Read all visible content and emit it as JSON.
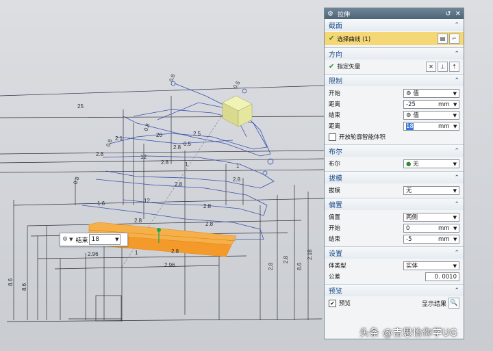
{
  "float_input": {
    "label": "结束",
    "value": "18"
  },
  "canvas": {
    "dims": [
      "0.8",
      "0.8",
      "0.8",
      "0.8",
      "25",
      "20",
      "2.1",
      "0.5",
      "2.5",
      "2.8",
      "2.8",
      "2.8",
      "2.8",
      "12",
      "12",
      "1",
      "1",
      "2.8",
      "2.8",
      "2.8",
      "2.8",
      "2.8",
      "1.6",
      "1",
      "2.96",
      "2.96",
      "8.6",
      "8.6",
      "2.8",
      "2.8",
      "2.18",
      "0.5",
      "8.6"
    ]
  },
  "dialog": {
    "title": "拉伸",
    "section_profile": {
      "title": "截面",
      "select_label": "选择曲线 (1)"
    },
    "section_direction": {
      "title": "方向",
      "vector_label": "指定矢量"
    },
    "section_limits": {
      "title": "限制",
      "start_label": "开始",
      "start_value": "值",
      "start_dist_label": "距离",
      "start_dist_value": "-25",
      "start_dist_unit": "mm",
      "end_label": "结束",
      "end_value": "值",
      "end_dist_label": "距离",
      "end_dist_value": "18",
      "end_dist_unit": "mm",
      "open_profile_label": "开放轮廓智能体积"
    },
    "section_boolean": {
      "title": "布尔",
      "label": "布尔",
      "value": "无"
    },
    "section_draft": {
      "title": "拔模",
      "label": "拔模",
      "value": "无"
    },
    "section_offset": {
      "title": "偏置",
      "offset_label": "偏置",
      "offset_value": "两侧",
      "start_label": "开始",
      "start_value": "0",
      "start_unit": "mm",
      "end_label": "结束",
      "end_value": "-5",
      "end_unit": "mm"
    },
    "section_settings": {
      "title": "设置",
      "body_type_label": "体类型",
      "body_type_value": "实体",
      "tolerance_label": "公差",
      "tolerance_value": "0. 0010"
    },
    "section_preview": {
      "title": "预览",
      "preview_label": "预览",
      "show_result_label": "显示结果"
    }
  },
  "watermark": "头条 @吉思怡你学UG",
  "colors": {
    "accent": "#1f4f8a",
    "highlight": "#f6d776",
    "sketch": "#3a4fae",
    "solid": "#f2a23a",
    "titlebar": "#5a7182"
  }
}
